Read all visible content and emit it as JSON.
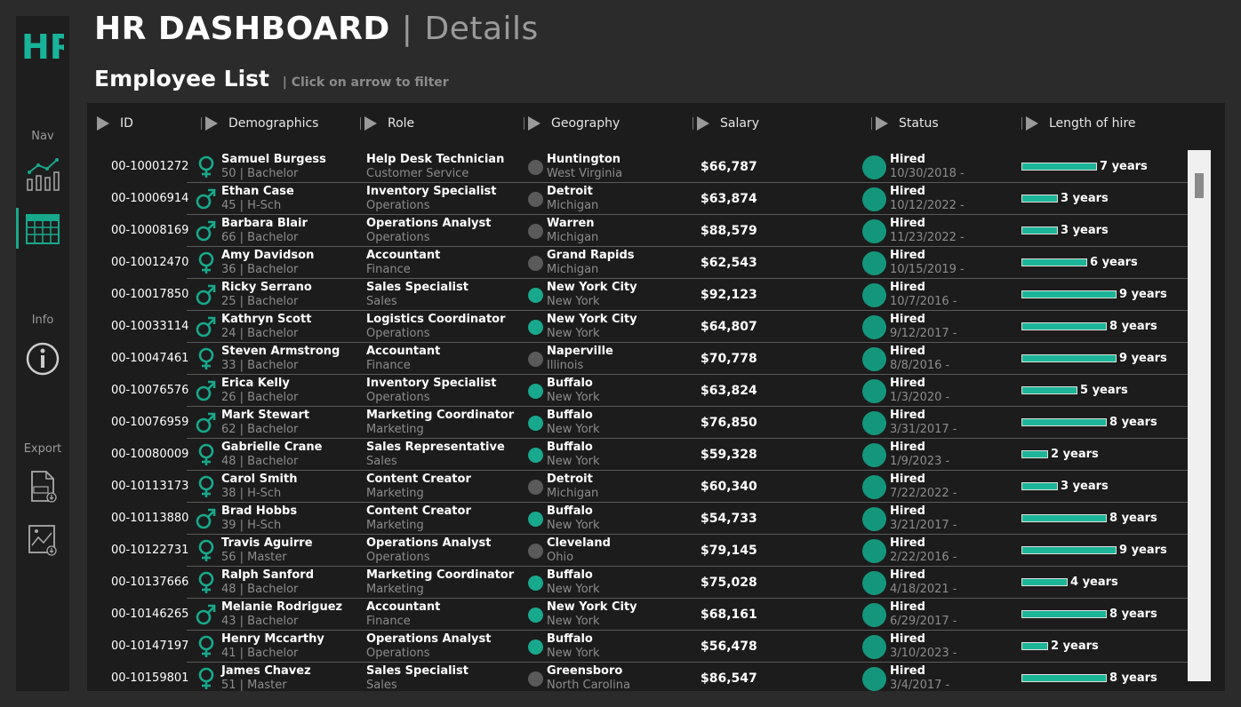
{
  "sidebar": {
    "logo_text": "HR",
    "nav_label": "Nav",
    "info_label": "Info",
    "export_label": "Export"
  },
  "header": {
    "title": "HR DASHBOARD",
    "separator": "|",
    "subtitle": "Details"
  },
  "section": {
    "title": "Employee List",
    "hint": "| Click on arrow to filter"
  },
  "columns": [
    "ID",
    "Demographics",
    "Role",
    "Geography",
    "Salary",
    "Status",
    "Length of hire"
  ],
  "colors": {
    "accent": "#18a88c",
    "bar": "#1cb597",
    "grey_dot": "#5a5a5a",
    "background": "#2b2b2b"
  },
  "rows": [
    {
      "id": "00-10001272",
      "gender": "female",
      "name": "Samuel Burgess",
      "demo": "50 | Bachelor",
      "role": "Help Desk Technician",
      "dept": "Customer Service",
      "city": "Huntington",
      "state": "West Virginia",
      "geo_color": "grey",
      "salary": "$66,787",
      "status": "Hired",
      "date": "10/30/2018 -",
      "years_num": 7,
      "years": "7 years"
    },
    {
      "id": "00-10006914",
      "gender": "male",
      "name": "Ethan Case",
      "demo": "45 | H-Sch",
      "role": "Inventory Specialist",
      "dept": "Operations",
      "city": "Detroit",
      "state": "Michigan",
      "geo_color": "grey",
      "salary": "$63,874",
      "status": "Hired",
      "date": "10/12/2022 -",
      "years_num": 3,
      "years": "3 years"
    },
    {
      "id": "00-10008169",
      "gender": "male",
      "name": "Barbara Blair",
      "demo": "66 | Bachelor",
      "role": "Operations Analyst",
      "dept": "Operations",
      "city": "Warren",
      "state": "Michigan",
      "geo_color": "grey",
      "salary": "$88,579",
      "status": "Hired",
      "date": "11/23/2022 -",
      "years_num": 3,
      "years": "3 years"
    },
    {
      "id": "00-10012470",
      "gender": "female",
      "name": "Amy Davidson",
      "demo": "36 | Bachelor",
      "role": "Accountant",
      "dept": "Finance",
      "city": "Grand Rapids",
      "state": "Michigan",
      "geo_color": "grey",
      "salary": "$62,543",
      "status": "Hired",
      "date": "10/15/2019 -",
      "years_num": 6,
      "years": "6 years"
    },
    {
      "id": "00-10017850",
      "gender": "male",
      "name": "Ricky Serrano",
      "demo": "25 | Bachelor",
      "role": "Sales Specialist",
      "dept": "Sales",
      "city": "New York City",
      "state": "New York",
      "geo_color": "green",
      "salary": "$92,123",
      "status": "Hired",
      "date": "10/7/2016 -",
      "years_num": 9,
      "years": "9 years"
    },
    {
      "id": "00-10033114",
      "gender": "male",
      "name": "Kathryn Scott",
      "demo": "24 | Bachelor",
      "role": "Logistics Coordinator",
      "dept": "Operations",
      "city": "New York City",
      "state": "New York",
      "geo_color": "green",
      "salary": "$64,807",
      "status": "Hired",
      "date": "9/12/2017 -",
      "years_num": 8,
      "years": "8 years"
    },
    {
      "id": "00-10047461",
      "gender": "female",
      "name": "Steven Armstrong",
      "demo": "33 | Bachelor",
      "role": "Accountant",
      "dept": "Finance",
      "city": "Naperville",
      "state": "Illinois",
      "geo_color": "grey",
      "salary": "$70,778",
      "status": "Hired",
      "date": "8/8/2016 -",
      "years_num": 9,
      "years": "9 years"
    },
    {
      "id": "00-10076576",
      "gender": "male",
      "name": "Erica Kelly",
      "demo": "26 | Bachelor",
      "role": "Inventory Specialist",
      "dept": "Operations",
      "city": "Buffalo",
      "state": "New York",
      "geo_color": "green",
      "salary": "$63,824",
      "status": "Hired",
      "date": "1/3/2020 -",
      "years_num": 5,
      "years": "5 years"
    },
    {
      "id": "00-10076959",
      "gender": "male",
      "name": "Mark Stewart",
      "demo": "62 | Bachelor",
      "role": "Marketing Coordinator",
      "dept": "Marketing",
      "city": "Buffalo",
      "state": "New York",
      "geo_color": "green",
      "salary": "$76,850",
      "status": "Hired",
      "date": "3/31/2017 -",
      "years_num": 8,
      "years": "8 years"
    },
    {
      "id": "00-10080009",
      "gender": "female",
      "name": "Gabrielle Crane",
      "demo": "48 | Bachelor",
      "role": "Sales Representative",
      "dept": "Sales",
      "city": "Buffalo",
      "state": "New York",
      "geo_color": "green",
      "salary": "$59,328",
      "status": "Hired",
      "date": "1/9/2023 -",
      "years_num": 2,
      "years": "2 years"
    },
    {
      "id": "00-10113173",
      "gender": "female",
      "name": "Carol Smith",
      "demo": "38 | H-Sch",
      "role": "Content Creator",
      "dept": "Marketing",
      "city": "Detroit",
      "state": "Michigan",
      "geo_color": "grey",
      "salary": "$60,340",
      "status": "Hired",
      "date": "7/22/2022 -",
      "years_num": 3,
      "years": "3 years"
    },
    {
      "id": "00-10113880",
      "gender": "male",
      "name": "Brad Hobbs",
      "demo": "39 | H-Sch",
      "role": "Content Creator",
      "dept": "Marketing",
      "city": "Buffalo",
      "state": "New York",
      "geo_color": "green",
      "salary": "$54,733",
      "status": "Hired",
      "date": "3/21/2017 -",
      "years_num": 8,
      "years": "8 years"
    },
    {
      "id": "00-10122731",
      "gender": "female",
      "name": "Travis Aguirre",
      "demo": "56 | Master",
      "role": "Operations Analyst",
      "dept": "Operations",
      "city": "Cleveland",
      "state": "Ohio",
      "geo_color": "grey",
      "salary": "$79,145",
      "status": "Hired",
      "date": "2/22/2016 -",
      "years_num": 9,
      "years": "9 years"
    },
    {
      "id": "00-10137666",
      "gender": "female",
      "name": "Ralph Sanford",
      "demo": "48 | Bachelor",
      "role": "Marketing Coordinator",
      "dept": "Marketing",
      "city": "Buffalo",
      "state": "New York",
      "geo_color": "green",
      "salary": "$75,028",
      "status": "Hired",
      "date": "4/18/2021 -",
      "years_num": 4,
      "years": "4 years"
    },
    {
      "id": "00-10146265",
      "gender": "male",
      "name": "Melanie Rodriguez",
      "demo": "43 | Bachelor",
      "role": "Accountant",
      "dept": "Finance",
      "city": "New York City",
      "state": "New York",
      "geo_color": "green",
      "salary": "$68,161",
      "status": "Hired",
      "date": "6/29/2017 -",
      "years_num": 8,
      "years": "8 years"
    },
    {
      "id": "00-10147197",
      "gender": "female",
      "name": "Henry Mccarthy",
      "demo": "41 | Bachelor",
      "role": "Operations Analyst",
      "dept": "Operations",
      "city": "Buffalo",
      "state": "New York",
      "geo_color": "green",
      "salary": "$56,478",
      "status": "Hired",
      "date": "3/10/2023 -",
      "years_num": 2,
      "years": "2 years"
    },
    {
      "id": "00-10159801",
      "gender": "female",
      "name": "James Chavez",
      "demo": "51 | Master",
      "role": "Sales Specialist",
      "dept": "Sales",
      "city": "Greensboro",
      "state": "North Carolina",
      "geo_color": "grey",
      "salary": "$86,547",
      "status": "Hired",
      "date": "3/4/2017 -",
      "years_num": 8,
      "years": "8 years"
    }
  ]
}
